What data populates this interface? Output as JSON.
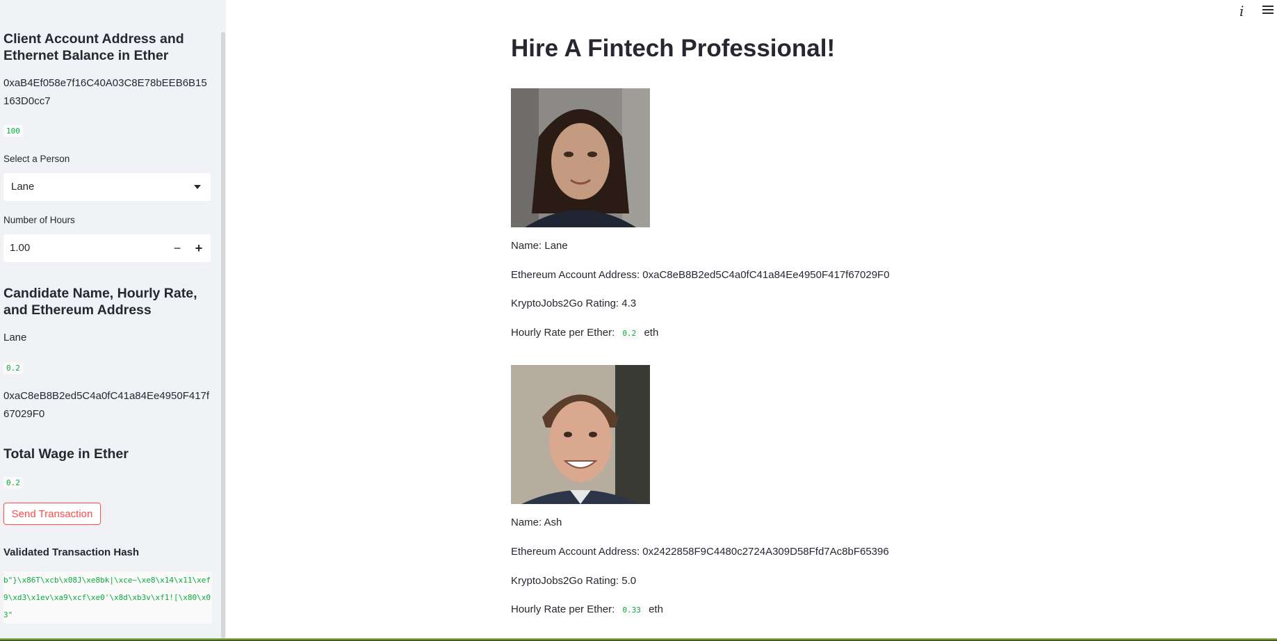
{
  "sidebar": {
    "account_heading": "Client Account Address and Ethernet Balance in Ether",
    "account_address": "0xaB4Ef058e7f16C40A03C8E78bEEB6B15163D0cc7",
    "balance": "100",
    "select_label": "Select a Person",
    "select_value": "Lane",
    "hours_label": "Number of Hours",
    "hours_value": "1.00",
    "minus_label": "−",
    "plus_label": "+",
    "candidate_heading": "Candidate Name, Hourly Rate, and Ethereum Address",
    "candidate_name": "Lane",
    "candidate_rate": "0.2",
    "candidate_address": "0xaC8eB8B2ed5C4a0fC41a84Ee4950F417f67029F0",
    "wage_heading": "Total Wage in Ether",
    "wage_value": "0.2",
    "send_button": "Send Transaction",
    "hash_heading": "Validated Transaction Hash",
    "hash_value": "b\"}\\x86T\\xcb\\x08J\\xe8bk|\\xce~\\xe8\\x14\\x11\\xef9\\xd3\\x1ev\\xa9\\xcf\\xe0'\\x8d\\xb3v\\xf1![\\x80\\x03\""
  },
  "topbar": {
    "info_icon": "i"
  },
  "main": {
    "title": "Hire A Fintech Professional!",
    "candidates": [
      {
        "name": "Name: Lane",
        "address": "Ethereum Account Address: 0xaC8eB8B2ed5C4a0fC41a84Ee4950F417f67029F0",
        "rating": "KryptoJobs2Go Rating: 4.3",
        "rate_prefix": "Hourly Rate per Ether:",
        "rate": "0.2",
        "rate_suffix": "eth"
      },
      {
        "name": "Name: Ash",
        "address": "Ethereum Account Address: 0x2422858F9C4480c2724A309D58Ffd7Ac8bF65396",
        "rating": "KryptoJobs2Go Rating: 5.0",
        "rate_prefix": "Hourly Rate per Ether:",
        "rate": "0.33",
        "rate_suffix": "eth"
      }
    ]
  }
}
